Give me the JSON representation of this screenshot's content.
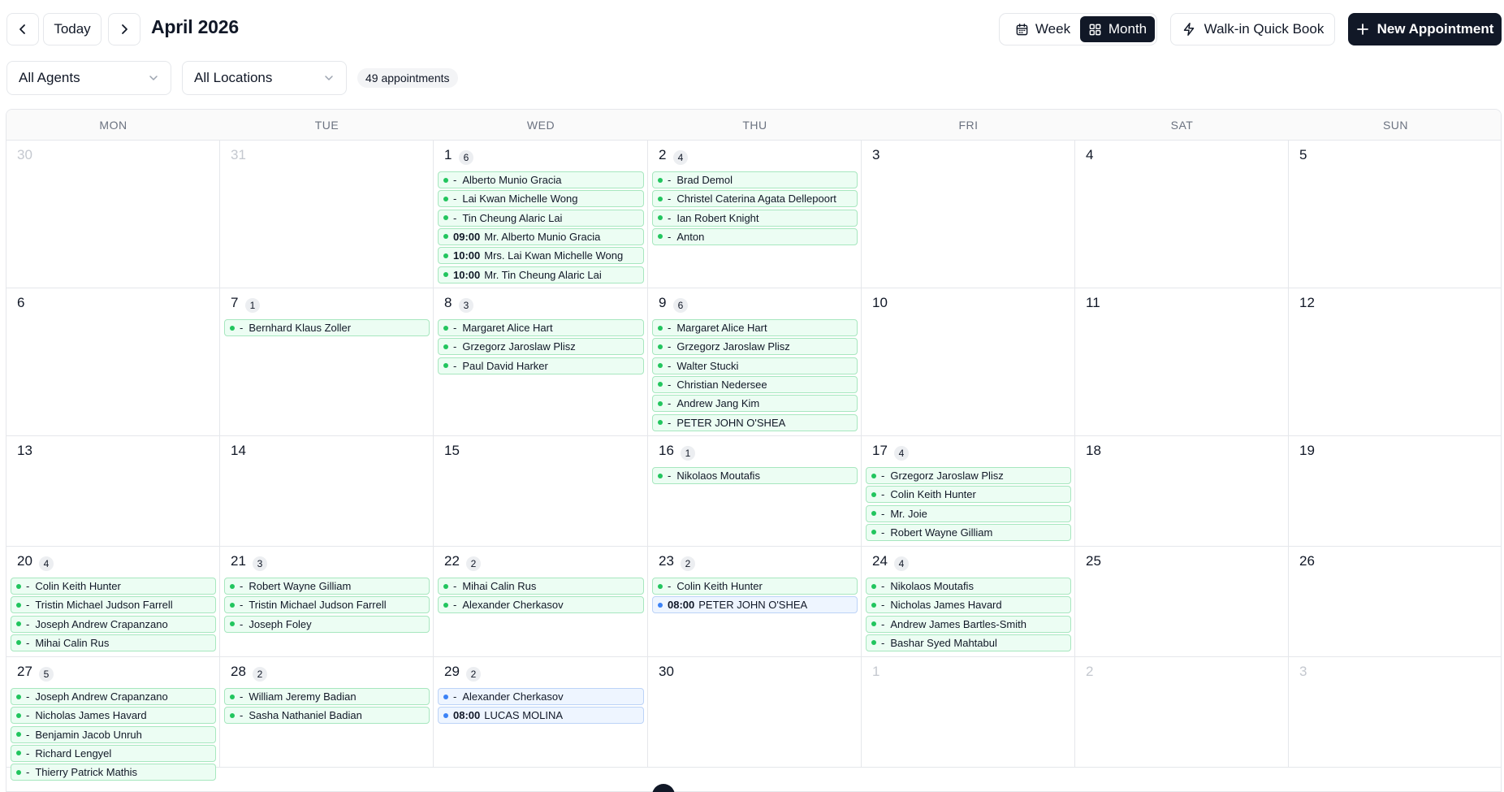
{
  "header": {
    "prev_icon": "chevron-left-icon",
    "today_label": "Today",
    "next_icon": "chevron-right-icon",
    "title": "April 2026",
    "week_label": "Week",
    "month_label": "Month",
    "walkin_label": "Walk-in Quick Book",
    "new_label": "New Appointment"
  },
  "filters": {
    "agents": "All Agents",
    "locations": "All Locations",
    "count": "49 appointments"
  },
  "weekdays": [
    "MON",
    "TUE",
    "WED",
    "THU",
    "FRI",
    "SAT",
    "SUN"
  ],
  "weeks": [
    [
      {
        "day": "30",
        "other": true,
        "count": "",
        "events": []
      },
      {
        "day": "31",
        "other": true,
        "count": "",
        "events": []
      },
      {
        "day": "1",
        "other": false,
        "count": "6",
        "events": [
          {
            "time": "-",
            "name": "Alberto Munio Gracia",
            "color": "green"
          },
          {
            "time": "-",
            "name": "Lai Kwan Michelle Wong",
            "color": "green"
          },
          {
            "time": "-",
            "name": "Tin Cheung Alaric Lai",
            "color": "green"
          },
          {
            "time": "09:00",
            "name": "Mr. Alberto Munio Gracia",
            "color": "green"
          },
          {
            "time": "10:00",
            "name": "Mrs. Lai Kwan Michelle Wong",
            "color": "green"
          },
          {
            "time": "10:00",
            "name": "Mr. Tin Cheung Alaric Lai",
            "color": "green"
          }
        ]
      },
      {
        "day": "2",
        "other": false,
        "count": "4",
        "events": [
          {
            "time": "-",
            "name": "Brad Demol",
            "color": "green"
          },
          {
            "time": "-",
            "name": "Christel Caterina Agata Dellepoort",
            "color": "green"
          },
          {
            "time": "-",
            "name": "Ian Robert Knight",
            "color": "green"
          },
          {
            "time": "-",
            "name": "Anton",
            "color": "green"
          }
        ]
      },
      {
        "day": "3",
        "other": false,
        "count": "",
        "events": []
      },
      {
        "day": "4",
        "other": false,
        "count": "",
        "events": []
      },
      {
        "day": "5",
        "other": false,
        "count": "",
        "events": []
      }
    ],
    [
      {
        "day": "6",
        "other": false,
        "count": "",
        "events": []
      },
      {
        "day": "7",
        "other": false,
        "count": "1",
        "events": [
          {
            "time": "-",
            "name": "Bernhard Klaus Zoller",
            "color": "green"
          }
        ]
      },
      {
        "day": "8",
        "other": false,
        "count": "3",
        "events": [
          {
            "time": "-",
            "name": "Margaret Alice Hart",
            "color": "green"
          },
          {
            "time": "-",
            "name": "Grzegorz Jaroslaw Plisz",
            "color": "green"
          },
          {
            "time": "-",
            "name": "Paul David Harker",
            "color": "green"
          }
        ]
      },
      {
        "day": "9",
        "other": false,
        "count": "6",
        "events": [
          {
            "time": "-",
            "name": "Margaret Alice Hart",
            "color": "green"
          },
          {
            "time": "-",
            "name": "Grzegorz Jaroslaw Plisz",
            "color": "green"
          },
          {
            "time": "-",
            "name": "Walter Stucki",
            "color": "green"
          },
          {
            "time": "-",
            "name": "Christian Nedersee",
            "color": "green"
          },
          {
            "time": "-",
            "name": "Andrew Jang Kim",
            "color": "green"
          },
          {
            "time": "-",
            "name": "PETER JOHN O'SHEA",
            "color": "green"
          }
        ]
      },
      {
        "day": "10",
        "other": false,
        "count": "",
        "events": []
      },
      {
        "day": "11",
        "other": false,
        "count": "",
        "events": []
      },
      {
        "day": "12",
        "other": false,
        "count": "",
        "events": []
      }
    ],
    [
      {
        "day": "13",
        "other": false,
        "count": "",
        "events": []
      },
      {
        "day": "14",
        "other": false,
        "count": "",
        "events": []
      },
      {
        "day": "15",
        "other": false,
        "count": "",
        "events": []
      },
      {
        "day": "16",
        "other": false,
        "count": "1",
        "events": [
          {
            "time": "-",
            "name": "Nikolaos Moutafis",
            "color": "green"
          }
        ]
      },
      {
        "day": "17",
        "other": false,
        "count": "4",
        "events": [
          {
            "time": "-",
            "name": "Grzegorz Jaroslaw Plisz",
            "color": "green"
          },
          {
            "time": "-",
            "name": "Colin Keith Hunter",
            "color": "green"
          },
          {
            "time": "-",
            "name": "Mr. Joie",
            "color": "green"
          },
          {
            "time": "-",
            "name": "Robert Wayne Gilliam",
            "color": "green"
          }
        ]
      },
      {
        "day": "18",
        "other": false,
        "count": "",
        "events": []
      },
      {
        "day": "19",
        "other": false,
        "count": "",
        "events": []
      }
    ],
    [
      {
        "day": "20",
        "other": false,
        "count": "4",
        "events": [
          {
            "time": "-",
            "name": "Colin Keith Hunter",
            "color": "green"
          },
          {
            "time": "-",
            "name": "Tristin Michael Judson Farrell",
            "color": "green"
          },
          {
            "time": "-",
            "name": "Joseph Andrew Crapanzano",
            "color": "green"
          },
          {
            "time": "-",
            "name": "Mihai Calin Rus",
            "color": "green"
          }
        ]
      },
      {
        "day": "21",
        "other": false,
        "count": "3",
        "events": [
          {
            "time": "-",
            "name": "Robert Wayne Gilliam",
            "color": "green"
          },
          {
            "time": "-",
            "name": "Tristin Michael Judson Farrell",
            "color": "green"
          },
          {
            "time": "-",
            "name": "Joseph Foley",
            "color": "green"
          }
        ]
      },
      {
        "day": "22",
        "other": false,
        "count": "2",
        "events": [
          {
            "time": "-",
            "name": "Mihai Calin Rus",
            "color": "green"
          },
          {
            "time": "-",
            "name": "Alexander Cherkasov",
            "color": "green"
          }
        ]
      },
      {
        "day": "23",
        "other": false,
        "count": "2",
        "events": [
          {
            "time": "-",
            "name": "Colin Keith Hunter",
            "color": "green"
          },
          {
            "time": "08:00",
            "name": "PETER JOHN O'SHEA",
            "color": "blue"
          }
        ]
      },
      {
        "day": "24",
        "other": false,
        "count": "4",
        "events": [
          {
            "time": "-",
            "name": "Nikolaos Moutafis",
            "color": "green"
          },
          {
            "time": "-",
            "name": "Nicholas James Havard",
            "color": "green"
          },
          {
            "time": "-",
            "name": "Andrew James Bartles-Smith",
            "color": "green"
          },
          {
            "time": "-",
            "name": "Bashar Syed Mahtabul",
            "color": "green"
          }
        ]
      },
      {
        "day": "25",
        "other": false,
        "count": "",
        "events": []
      },
      {
        "day": "26",
        "other": false,
        "count": "",
        "events": []
      }
    ],
    [
      {
        "day": "27",
        "other": false,
        "count": "5",
        "events": [
          {
            "time": "-",
            "name": "Joseph Andrew Crapanzano",
            "color": "green"
          },
          {
            "time": "-",
            "name": "Nicholas James Havard",
            "color": "green"
          },
          {
            "time": "-",
            "name": "Benjamin Jacob Unruh",
            "color": "green"
          },
          {
            "time": "-",
            "name": "Richard Lengyel",
            "color": "green"
          },
          {
            "time": "-",
            "name": "Thierry Patrick Mathis",
            "color": "green"
          }
        ]
      },
      {
        "day": "28",
        "other": false,
        "count": "2",
        "events": [
          {
            "time": "-",
            "name": "William Jeremy Badian",
            "color": "green"
          },
          {
            "time": "-",
            "name": "Sasha Nathaniel Badian",
            "color": "green"
          }
        ]
      },
      {
        "day": "29",
        "other": false,
        "count": "2",
        "events": [
          {
            "time": "-",
            "name": "Alexander Cherkasov",
            "color": "blue"
          },
          {
            "time": "08:00",
            "name": "LUCAS MOLINA",
            "color": "blue"
          }
        ]
      },
      {
        "day": "30",
        "other": false,
        "count": "",
        "events": []
      },
      {
        "day": "1",
        "other": true,
        "count": "",
        "events": []
      },
      {
        "day": "2",
        "other": true,
        "count": "",
        "events": []
      },
      {
        "day": "3",
        "other": true,
        "count": "",
        "events": []
      }
    ]
  ],
  "colors": {
    "primary": "#111827",
    "event_green_bg": "#ecfdf3",
    "event_green_dot": "#22c55e",
    "event_blue_bg": "#eef5ff",
    "event_blue_dot": "#3b82f6"
  }
}
